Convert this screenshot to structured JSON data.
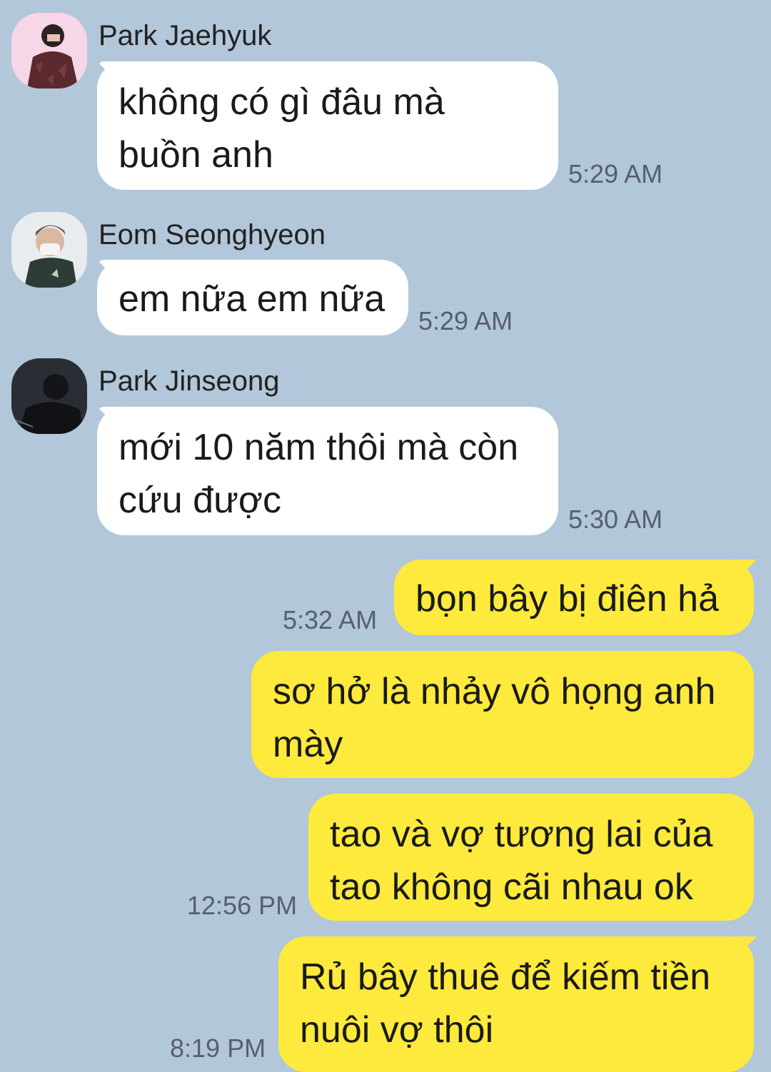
{
  "incoming": [
    {
      "sender": "Park Jaehyuk",
      "text": "không có gì đâu mà\nbuồn anh",
      "time": "5:29 AM"
    },
    {
      "sender": "Eom Seonghyeon",
      "text": "em nữa em nữa",
      "time": "5:29 AM"
    },
    {
      "sender": "Park Jinseong",
      "text": "mới 10 năm thôi mà còn\ncứu được",
      "time": "5:30 AM"
    }
  ],
  "outgoing": [
    {
      "text": "bọn bây bị điên hả",
      "time": "5:32 AM"
    },
    {
      "text": "sơ hở là nhảy vô họng anh\nmày",
      "time": ""
    },
    {
      "text": "tao và vợ tương lai của\ntao không cãi nhau ok",
      "time": "12:56 PM"
    },
    {
      "text": "Rủ bây thuê để kiếm tiền\nnuôi vợ thôi",
      "time": "8:19 PM"
    }
  ],
  "colors": {
    "background": "#b2c7d9",
    "incoming_bubble": "#ffffff",
    "outgoing_bubble": "#fdea3c"
  }
}
